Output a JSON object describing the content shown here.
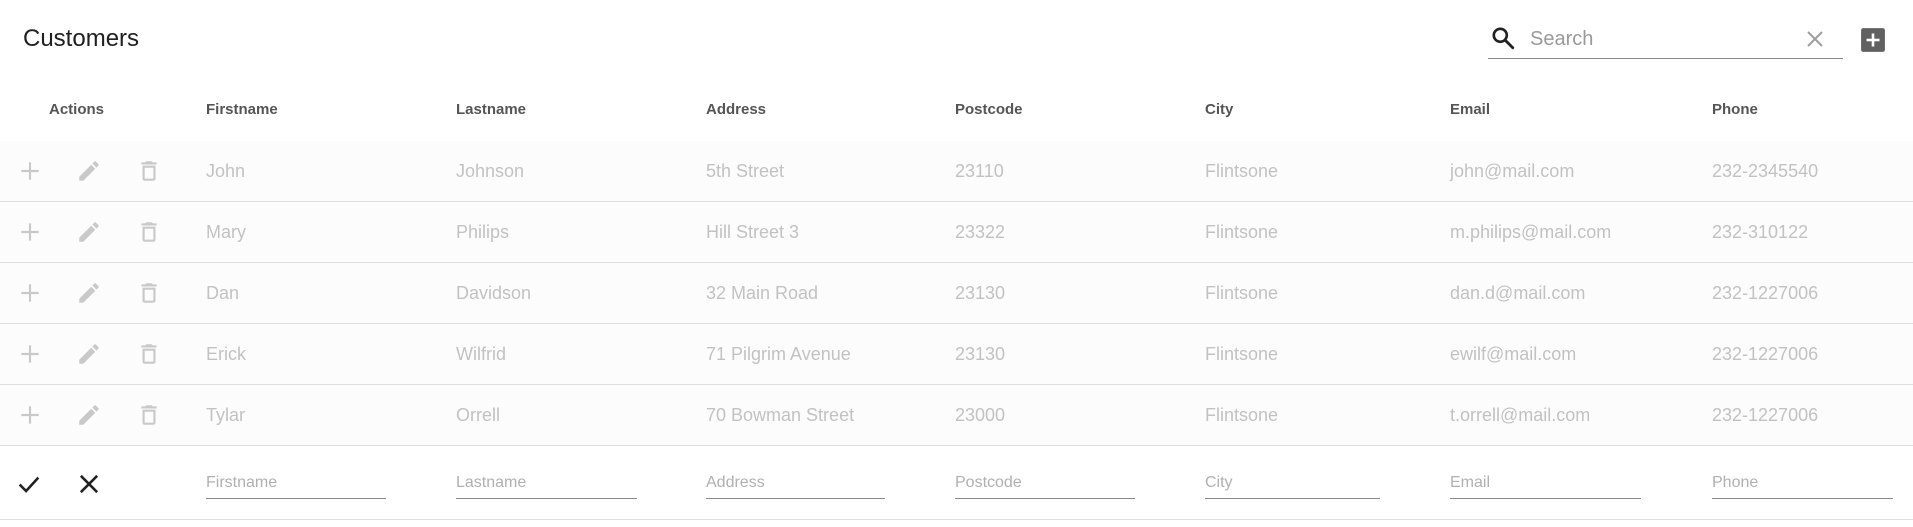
{
  "title": "Customers",
  "search": {
    "placeholder": "Search",
    "value": ""
  },
  "columns": {
    "actions": "Actions",
    "firstname": "Firstname",
    "lastname": "Lastname",
    "address": "Address",
    "postcode": "Postcode",
    "city": "City",
    "email": "Email",
    "phone": "Phone"
  },
  "rows": [
    {
      "firstname": "John",
      "lastname": "Johnson",
      "address": "5th Street",
      "postcode": "23110",
      "city": "Flintsone",
      "email": "john@mail.com",
      "phone": "232-2345540"
    },
    {
      "firstname": "Mary",
      "lastname": "Philips",
      "address": "Hill Street 3",
      "postcode": "23322",
      "city": "Flintsone",
      "email": "m.philips@mail.com",
      "phone": "232-310122"
    },
    {
      "firstname": "Dan",
      "lastname": "Davidson",
      "address": "32 Main Road",
      "postcode": "23130",
      "city": "Flintsone",
      "email": "dan.d@mail.com",
      "phone": "232-1227006"
    },
    {
      "firstname": "Erick",
      "lastname": "Wilfrid",
      "address": "71 Pilgrim Avenue",
      "postcode": "23130",
      "city": "Flintsone",
      "email": "ewilf@mail.com",
      "phone": "232-1227006"
    },
    {
      "firstname": "Tylar",
      "lastname": "Orrell",
      "address": "70 Bowman Street",
      "postcode": "23000",
      "city": "Flintsone",
      "email": "t.orrell@mail.com",
      "phone": "232-1227006"
    }
  ],
  "new_row": {
    "placeholders": {
      "firstname": "Firstname",
      "lastname": "Lastname",
      "address": "Address",
      "postcode": "Postcode",
      "city": "City",
      "email": "Email",
      "phone": "Phone"
    },
    "values": {
      "firstname": "",
      "lastname": "",
      "address": "",
      "postcode": "",
      "city": "",
      "email": "",
      "phone": ""
    }
  },
  "icons": {
    "search": "search-icon",
    "clear": "close-icon",
    "add": "add-box-icon",
    "row_add": "plus-icon",
    "row_edit": "pencil-icon",
    "row_delete": "trash-icon",
    "confirm": "check-icon",
    "cancel": "close-icon"
  },
  "colors": {
    "text": "#212121",
    "header_text": "#555555",
    "disabled_text": "#c2c2c2",
    "disabled_icon": "#c9c9c9",
    "row_bg": "#fcfcfc",
    "divider": "#dedede",
    "active_icon": "#212121",
    "add_button": "#616161"
  }
}
